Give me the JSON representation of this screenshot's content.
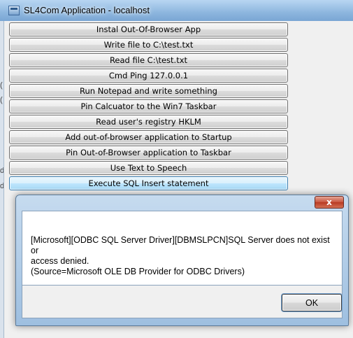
{
  "window": {
    "title": "SL4Com Application - localhost"
  },
  "buttons": [
    {
      "label": "Instal Out-Of-Browser App"
    },
    {
      "label": "Write file to C:\\test.txt"
    },
    {
      "label": "Read file C:\\test.txt"
    },
    {
      "label": "Cmd Ping 127.0.0.1"
    },
    {
      "label": "Run Notepad and write something"
    },
    {
      "label": "Pin Calcuator to the Win7 Taskbar"
    },
    {
      "label": "Read user's registry HKLM"
    },
    {
      "label": "Add out-of-browser application to Startup"
    },
    {
      "label": "Pin Out-of-Browser application to Taskbar"
    },
    {
      "label": "Use Text to Speech"
    },
    {
      "label": "Execute SQL Insert statement"
    }
  ],
  "left_chars": [
    "(",
    "(",
    "d",
    "d"
  ],
  "dialog": {
    "close_label": "x",
    "message_line1": "[Microsoft][ODBC SQL Server Driver][DBMSLPCN]SQL Server does not exist or",
    "message_line2": "access denied.",
    "message_line3": "(Source=Microsoft OLE DB Provider for ODBC Drivers)",
    "ok_label": "OK"
  }
}
